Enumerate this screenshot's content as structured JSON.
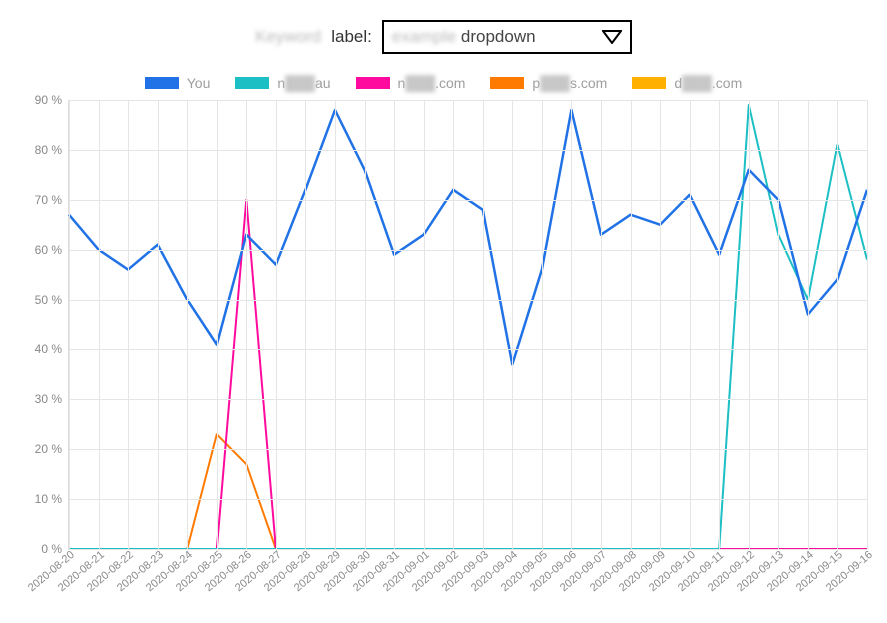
{
  "control": {
    "keyword_blurred": "Keyword",
    "label": "label:",
    "dropdown_blurred": "example",
    "dropdown_text": "dropdown"
  },
  "legend": [
    {
      "color": "#2072e6",
      "prefix": "",
      "label": "You",
      "blurred": false
    },
    {
      "color": "#1cbfc4",
      "prefix": "n",
      "label": "au",
      "blurred": true
    },
    {
      "color": "#ff0a9e",
      "prefix": "n",
      "label": ".com",
      "blurred": true
    },
    {
      "color": "#ff7a00",
      "prefix": "p",
      "label": "s.com",
      "blurred": true
    },
    {
      "color": "#ffb000",
      "prefix": "d",
      "label": ".com",
      "blurred": true
    }
  ],
  "chart_data": {
    "type": "line",
    "xlabel": "",
    "ylabel": "",
    "ylim": [
      0,
      90
    ],
    "y_ticks": [
      0,
      10,
      20,
      30,
      40,
      50,
      60,
      70,
      80,
      90
    ],
    "y_tick_suffix": " %",
    "categories": [
      "2020-08-20",
      "2020-08-21",
      "2020-08-22",
      "2020-08-23",
      "2020-08-24",
      "2020-08-25",
      "2020-08-26",
      "2020-08-27",
      "2020-08-28",
      "2020-08-29",
      "2020-08-30",
      "2020-08-31",
      "2020-09-01",
      "2020-09-02",
      "2020-09-03",
      "2020-09-04",
      "2020-09-05",
      "2020-09-06",
      "2020-09-07",
      "2020-09-08",
      "2020-09-09",
      "2020-09-10",
      "2020-09-11",
      "2020-09-12",
      "2020-09-13",
      "2020-09-14",
      "2020-09-15",
      "2020-09-16"
    ],
    "series": [
      {
        "name": "You",
        "color": "#2072e6",
        "values": [
          67,
          60,
          56,
          61,
          50,
          41,
          63,
          57,
          72,
          88,
          76,
          59,
          63,
          72,
          68,
          37,
          56,
          88,
          63,
          67,
          65,
          71,
          59,
          76,
          70,
          47,
          54,
          72
        ]
      },
      {
        "name": "n...au",
        "color": "#1cbfc4",
        "values": [
          0,
          0,
          0,
          0,
          0,
          0,
          0,
          0,
          0,
          0,
          0,
          0,
          0,
          0,
          0,
          0,
          0,
          0,
          0,
          0,
          0,
          0,
          0,
          89,
          63,
          50,
          81,
          58
        ]
      },
      {
        "name": "n....com",
        "color": "#ff0a9e",
        "values": [
          0,
          0,
          0,
          0,
          0,
          0,
          70,
          0,
          0,
          0,
          0,
          0,
          0,
          0,
          0,
          0,
          0,
          0,
          0,
          0,
          0,
          0,
          0,
          0,
          0,
          0,
          0,
          0
        ]
      },
      {
        "name": "p...s.com",
        "color": "#ff7a00",
        "values": [
          0,
          0,
          0,
          0,
          0,
          23,
          17,
          0,
          0,
          0,
          0,
          0,
          0,
          0,
          0,
          0,
          0,
          0,
          0,
          0,
          0,
          0,
          0,
          0,
          0,
          0,
          0,
          0
        ]
      },
      {
        "name": "d....com",
        "color": "#ffb000",
        "values": [
          0,
          0,
          0,
          0,
          0,
          0,
          0,
          0,
          0,
          0,
          0,
          0,
          0,
          0,
          0,
          0,
          0,
          0,
          0,
          0,
          0,
          0,
          0,
          0,
          0,
          0,
          0,
          0
        ]
      }
    ]
  }
}
